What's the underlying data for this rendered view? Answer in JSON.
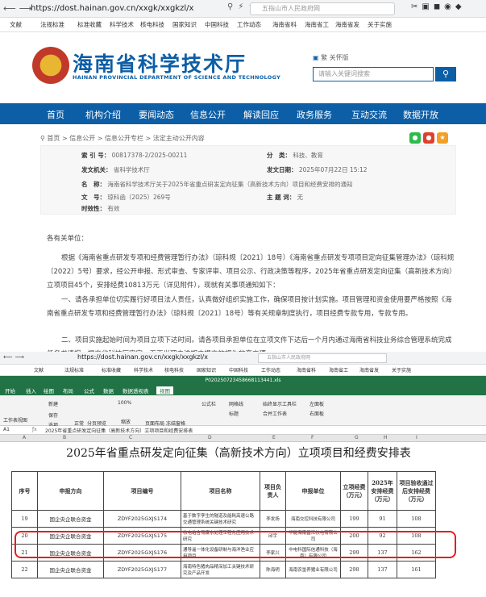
{
  "browser": {
    "url": "https://dost.hainan.gov.cn/xxgk/xxgkzl/x",
    "search_placeholder": "五指山市人民政府网",
    "bookmarks": [
      "文献",
      "法规标准",
      "标准收藏",
      "科学技术",
      "核电科技",
      "国家知识",
      "中国科技",
      "工作动态",
      "海南省科",
      "海南省工",
      "海南省发",
      "关于实施"
    ]
  },
  "site": {
    "title": "海南省科学技术厅",
    "subtitle": "HAINAN PROVINCIAL DEPARTMENT OF SCIENCE AND TECHNOLOGY",
    "toplinks": "繁  关怀版",
    "search_placeholder": "请输入关键词搜索",
    "nav": [
      "首页",
      "机构介绍",
      "要闻动态",
      "信息公开",
      "解读回应",
      "政务服务",
      "互动交流",
      "数据开放"
    ]
  },
  "breadcrumb": "首页 > 信息公开 > 信息公开专栏 > 法定主动公开内容",
  "meta": {
    "index_label": "索 引 号：",
    "index_value": "00817378-2/2025-00211",
    "category_label": "分　类：",
    "category_value": "科技、教育",
    "issuer_label": "发文机关：",
    "issuer_value": "省科学技术厅",
    "date_label": "发文日期：",
    "date_value": "2025年07月22日 15:12",
    "name_label": "名　称：",
    "name_value": "海南省科学技术厅关于2025年省重点研发定向征集（高新技术方向）项目和经费安排的通知",
    "docno_label": "文　号：",
    "docno_value": "琼科函（2025）269号",
    "keywords_label": "主 题 词：",
    "keywords_value": "无",
    "validity_label": "时效性：",
    "validity_value": "有效"
  },
  "body": {
    "greeting": "各有关单位：",
    "p1": "根据《海南省重点研发专项和经费管理暂行办法》（琼科规〔2021〕18号）《海南省重点研发专项项目定向征集管理办法》（琼科规〔2022〕5号）要求，经公开申报、形式审查、专家评审、项目公示、行政决策等程序，2025年省重点研发定向征集（高新技术方向）立项项目45个，安排经费10813万元（详见附件），现就有关事项通知如下：",
    "p2": "一、请各承担单位切实履行好项目法人责任，认真做好组织实施工作，确保项目按计划实施。项目管理和资金使用要严格按照《海南省重点研发专项和经费管理暂行办法》（琼科规〔2021〕18号）等有关规章制度执行，项目经费专款专用，专款专用。",
    "p3": "二、项目实施起始时间为项目立项下达时间。请各项目承担单位在立项文件下达后一个月内通过海南省科技业务综合管理系统完成任务书填报，提交省科技厅审定。无正当理由逾期未提交的视为放弃立项。"
  },
  "excel": {
    "filename": "P020250723458668113441.xls",
    "tabs": [
      "开始",
      "插入",
      "绘图",
      "布局",
      "公式",
      "数据",
      "数据透视表",
      "视图"
    ],
    "active_tab": "视图",
    "ribbon": [
      "工作表视图",
      "新建",
      "保存",
      "选项",
      "正常",
      "分页预览",
      "100%",
      "缩放",
      "页面布局",
      "冻结窗格",
      "公式栏",
      "网格线",
      "标题",
      "始终显示工具栏",
      "合并工作表",
      "左面板",
      "右面板"
    ],
    "cell_ref": "A1",
    "formula": "2025年省重点研发定向征集（高新技术方向）立项项目和经费安排表",
    "columns": [
      "A",
      "B",
      "C",
      "D",
      "E",
      "F",
      "G",
      "H",
      "I"
    ],
    "sheet_title": "2025年省重点研发定向征集（高新技术方向）立项项目和经费安排表",
    "headers": [
      "序号",
      "申报方向",
      "项目编号",
      "项目名称",
      "项目负责人",
      "申报单位",
      "立项经费（万元）",
      "2025年安排经费（万元）",
      "项目验收通过后安排经费（万元）"
    ],
    "rows": [
      {
        "rownum": "19",
        "no": "19",
        "dir": "国企央企联合资金",
        "code": "ZDYF2025GXJS174",
        "name": "基于数字孪生的隧道及能耗高速公路交通管理系统关键技术研究",
        "lead": "李发扬",
        "unit": "海南交控科技有限公司",
        "total": "199",
        "y2025": "91",
        "after": "108"
      },
      {
        "rownum": "20",
        "no": "20",
        "dir": "国企央企联合资金",
        "code": "ZDYF2025GXJS175",
        "name": "核电站含氚废水处理工程化应用技术研究",
        "lead": "邱宇",
        "unit": "华能海南昌江核电有限公司",
        "total": "200",
        "y2025": "92",
        "after": "108"
      },
      {
        "rownum": "21",
        "no": "21",
        "dir": "国企央企联合资金",
        "code": "ZDYF2025GXJS176",
        "name": "通导遥一体化设备研制与海洋渔业应用项目",
        "lead": "李家兴",
        "unit": "中电科国际信通科技（海南）有限公司",
        "total": "299",
        "y2025": "137",
        "after": "162"
      },
      {
        "rownum": "22",
        "no": "22",
        "dir": "国企央企联合资金",
        "code": "ZDYF2025GXJS177",
        "name": "海南特色猪肉品精深加工关键技术研究及产品开发",
        "lead": "陈海明",
        "unit": "海南农垦养猪业有限公司",
        "total": "298",
        "y2025": "137",
        "after": "161"
      }
    ]
  }
}
